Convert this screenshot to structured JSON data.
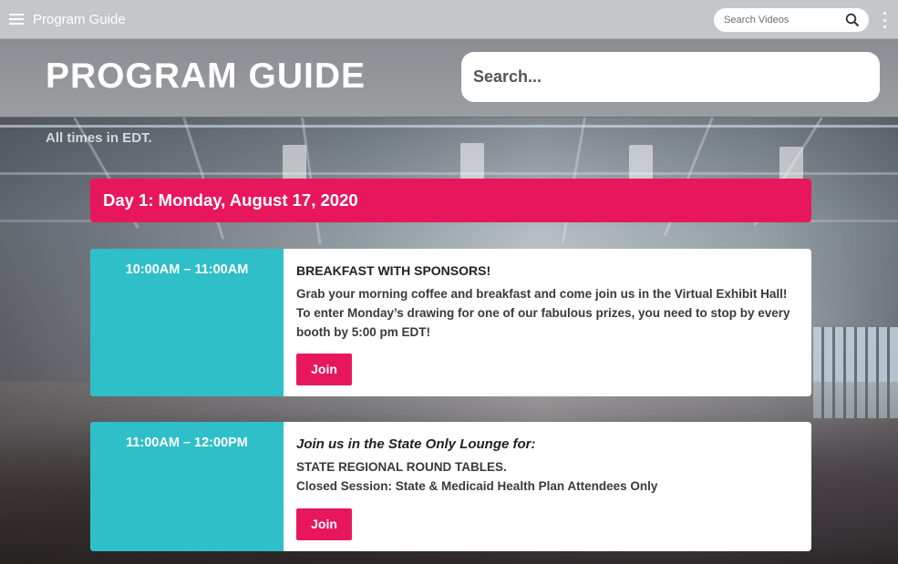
{
  "appbar": {
    "title": "Program Guide",
    "search_placeholder": "Search Videos",
    "icons": [
      "menu-icon",
      "search-icon",
      "more-vert-icon"
    ]
  },
  "header": {
    "title": "PROGRAM GUIDE",
    "search_placeholder": "Search..."
  },
  "timezone_note": "All times in EDT.",
  "day": {
    "label": "Day 1: Monday, August 17, 2020"
  },
  "sessions": [
    {
      "time": "10:00AM – 11:00AM",
      "title": "BREAKFAST WITH SPONSORS!",
      "lines": [
        "Grab your morning coffee and breakfast and come join us in the Virtual Exhibit Hall!",
        "To enter Monday’s drawing for one of our fabulous prizes, you need to stop by every booth by 5:00 pm EDT!"
      ],
      "button": "Join"
    },
    {
      "time": "11:00AM – 12:00PM",
      "title": "Join us in the State Only Lounge for:",
      "lines": [
        "STATE REGIONAL ROUND TABLES.",
        "Closed Session: State & Medicaid Health Plan Attendees Only"
      ],
      "button": "Join"
    }
  ],
  "colors": {
    "accent_pink": "#e8175d",
    "time_teal": "#2ebfc8",
    "appbar_gray": "#c4c7c9"
  }
}
